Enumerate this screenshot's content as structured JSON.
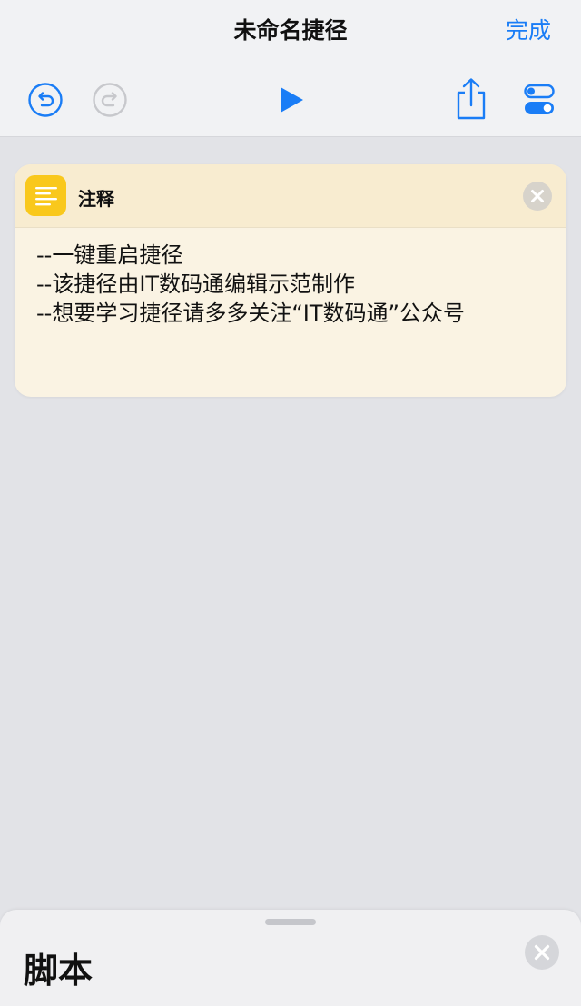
{
  "header": {
    "title": "未命名捷径",
    "done_label": "完成"
  },
  "toolbar": {
    "undo_icon": "undo-icon",
    "redo_icon": "redo-icon",
    "play_icon": "play-icon",
    "share_icon": "share-icon",
    "settings_icon": "toggle-settings-icon"
  },
  "comment_action": {
    "title": "注释",
    "icon": "text-lines-icon",
    "lines": [
      "--一键重启捷径",
      "--该捷径由IT数码通编辑示范制作",
      "--想要学习捷径请多多关注“IT数码通”公众号"
    ]
  },
  "bottom_sheet": {
    "title": "脚本"
  },
  "colors": {
    "accent": "#1a7df6",
    "card_header_bg": "#f8ecd0",
    "card_body_bg": "#faf3e3",
    "icon_bg": "#f9c81c",
    "page_bg": "#e2e3e7",
    "header_bg": "#f1f2f4"
  }
}
